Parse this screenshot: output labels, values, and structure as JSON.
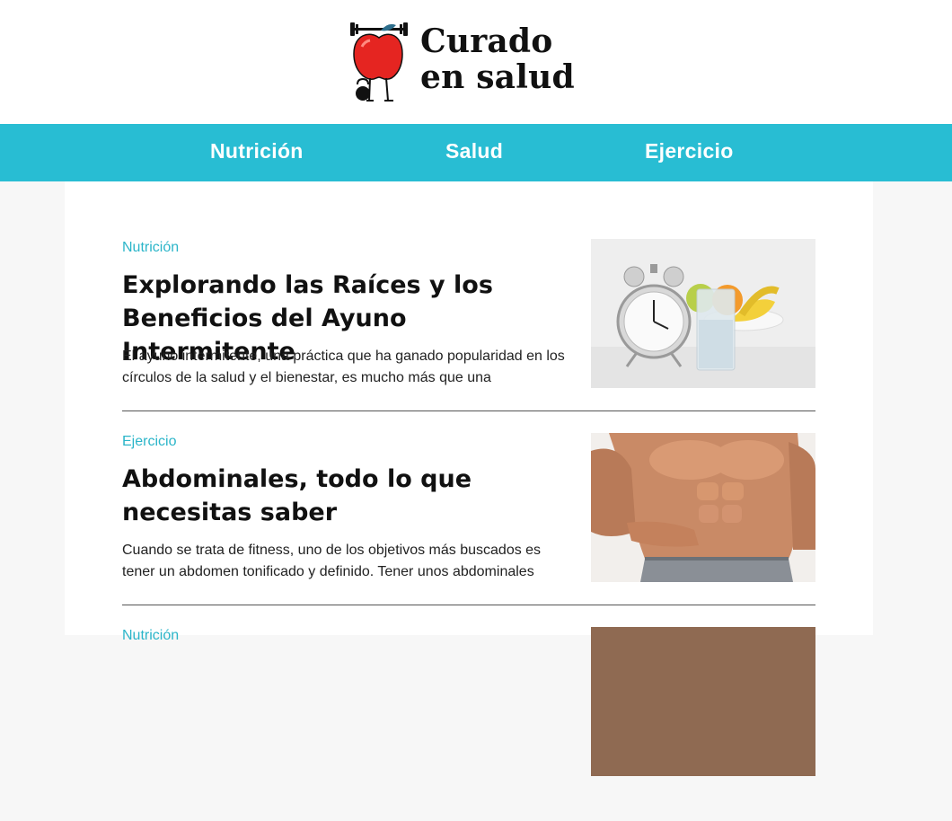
{
  "site": {
    "logo_line1": "Curado",
    "logo_line2": "en salud"
  },
  "nav": {
    "items": [
      "Nutrición",
      "Salud",
      "Ejercicio"
    ]
  },
  "articles": [
    {
      "category": "Nutrición",
      "title": "Explorando las Raíces y los Beneficios del Ayuno Intermitente",
      "excerpt": "El ayuno intermitente, una práctica que ha ganado popularidad en los círculos de la salud y el bienestar, es mucho más que una"
    },
    {
      "category": "Ejercicio",
      "title": "Abdominales, todo lo que necesitas saber",
      "excerpt": "Cuando se trata de fitness, uno de los objetivos más buscados es tener un abdomen tonificado y definido. Tener unos abdominales"
    },
    {
      "category": "Nutrición"
    }
  ],
  "colors": {
    "accent": "#28bdd3",
    "category_text": "#2bb5c9",
    "logo_apple": "#e52521"
  }
}
